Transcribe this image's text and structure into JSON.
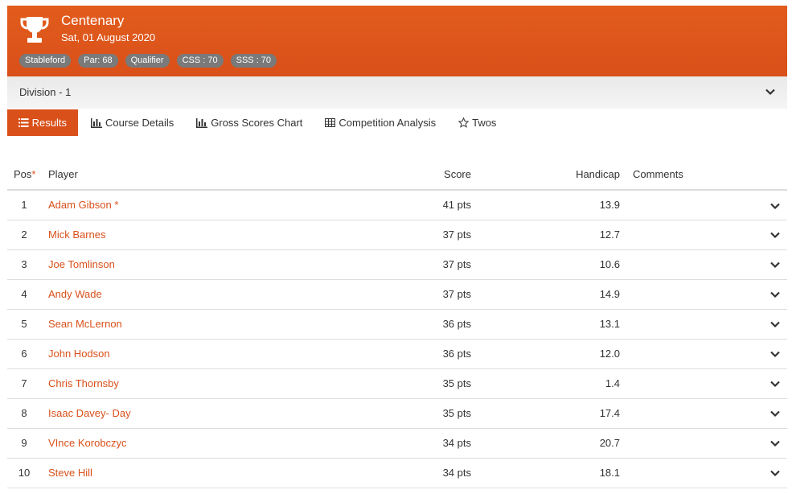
{
  "competition": {
    "title": "Centenary",
    "date": "Sat, 01 August 2020",
    "tags": [
      "Stableford",
      "Par: 68",
      "Qualifier",
      "CSS : 70",
      "SSS : 70"
    ]
  },
  "division": {
    "label": "Division - 1"
  },
  "tabs": [
    {
      "label": "Results",
      "icon": "list-icon",
      "active": true
    },
    {
      "label": "Course Details",
      "icon": "bar-chart-icon",
      "active": false
    },
    {
      "label": "Gross Scores Chart",
      "icon": "bar-chart-icon",
      "active": false
    },
    {
      "label": "Competition Analysis",
      "icon": "table-icon",
      "active": false
    },
    {
      "label": "Twos",
      "icon": "star-icon",
      "active": false
    }
  ],
  "table": {
    "headers": {
      "pos": "Pos",
      "pos_marker": "*",
      "player": "Player",
      "score": "Score",
      "handicap": "Handicap",
      "comments": "Comments"
    },
    "rows": [
      {
        "pos": "1",
        "player": "Adam Gibson *",
        "score": "41 pts",
        "handicap": "13.9",
        "comments": ""
      },
      {
        "pos": "2",
        "player": "Mick Barnes",
        "score": "37 pts",
        "handicap": "12.7",
        "comments": ""
      },
      {
        "pos": "3",
        "player": "Joe Tomlinson",
        "score": "37 pts",
        "handicap": "10.6",
        "comments": ""
      },
      {
        "pos": "4",
        "player": "Andy Wade",
        "score": "37 pts",
        "handicap": "14.9",
        "comments": ""
      },
      {
        "pos": "5",
        "player": "Sean McLernon",
        "score": "36 pts",
        "handicap": "13.1",
        "comments": ""
      },
      {
        "pos": "6",
        "player": "John Hodson",
        "score": "36 pts",
        "handicap": "12.0",
        "comments": ""
      },
      {
        "pos": "7",
        "player": "Chris Thornsby",
        "score": "35 pts",
        "handicap": "1.4",
        "comments": ""
      },
      {
        "pos": "8",
        "player": "Isaac Davey- Day",
        "score": "35 pts",
        "handicap": "17.4",
        "comments": ""
      },
      {
        "pos": "9",
        "player": "VInce Korobczyc",
        "score": "34 pts",
        "handicap": "20.7",
        "comments": ""
      },
      {
        "pos": "10",
        "player": "Steve Hill",
        "score": "34 pts",
        "handicap": "18.1",
        "comments": ""
      }
    ]
  },
  "colors": {
    "accent": "#d9501a",
    "tag_bg": "#7a7a7a",
    "division_bg": "#eeeeee"
  }
}
